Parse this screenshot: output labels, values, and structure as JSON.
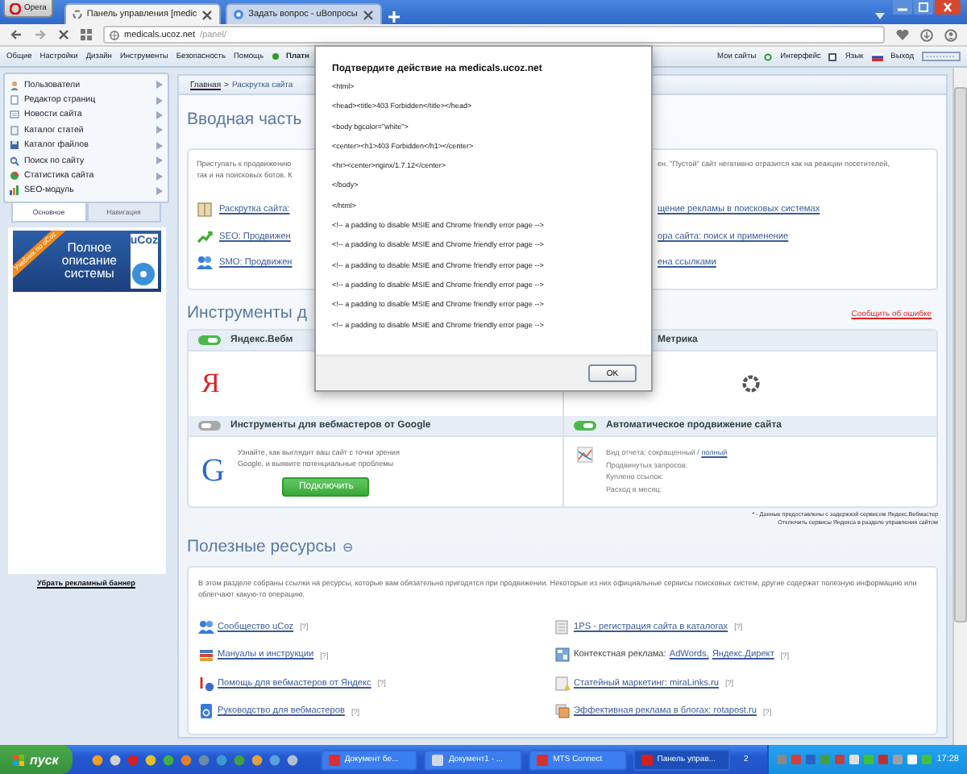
{
  "browser": {
    "opera_button": "Opera",
    "tabs": [
      {
        "title": "Панель управления [medic",
        "selected": true
      },
      {
        "title": "Задать вопрос - uВопросы",
        "selected": false
      }
    ],
    "address": {
      "host": "medicals.ucoz.net",
      "path": "/panel/"
    }
  },
  "top_menu": {
    "items": [
      {
        "label": "Общие",
        "kind": "plain"
      },
      {
        "label": "Настройки",
        "kind": "plain"
      },
      {
        "label": "Дизайн",
        "kind": "plain"
      },
      {
        "label": "Инструменты",
        "kind": "plain"
      },
      {
        "label": "Безопасность",
        "kind": "plain"
      },
      {
        "label": "Помощь",
        "kind": "plain"
      },
      {
        "label": "Платн",
        "kind": "paid"
      }
    ],
    "right": [
      {
        "label": "Мои сайты",
        "kind": "refresh"
      },
      {
        "label": "Интерфейс",
        "kind": "window"
      },
      {
        "label": "Язык",
        "kind": "flag"
      },
      {
        "label": "Выход",
        "kind": "plain"
      }
    ]
  },
  "sidebar": {
    "items": [
      "Пользователи",
      "Редактор страниц",
      "Новости сайта",
      "Каталог статей",
      "Каталог файлов",
      "Поиск по сайту",
      "Статистика сайта",
      "SEO-модуль"
    ],
    "tabs": [
      {
        "label": "Основное",
        "selected": true
      },
      {
        "label": "Навигация",
        "selected": false
      }
    ],
    "banner": {
      "ribbon": "Учебник по uCoz",
      "text": "Полное описание системы",
      "logo": "uCoz"
    },
    "remove_banner_link": "Убрать рекламный баннер"
  },
  "breadcrumb": {
    "items": [
      "Главная",
      "Раскрутка сайта"
    ],
    "separator": ">"
  },
  "intro": {
    "title": "Вводная часть",
    "text_left": [
      "Приступать к продвижению",
      "так и на поисковых ботов. К"
    ],
    "text_right": [
      "ен. \"Пустой\" сайт негативно отразится как на реакции посетителей,"
    ],
    "links_left": [
      {
        "kind": "book",
        "label": "Раскрутка сайта:"
      },
      {
        "kind": "growth",
        "label": "SEO: Продвижен"
      },
      {
        "kind": "people",
        "label": "SMO: Продвижен"
      }
    ],
    "links_right": [
      "щение рекламы в поисковых системах",
      "ора сайта: поиск и применение",
      "ена ссылками"
    ]
  },
  "tools": {
    "title": "Инструменты д",
    "report_link": "Сообщить об ошибке",
    "cards": [
      {
        "kind": "yandex",
        "title": "Яндекс.Вебм",
        "on": true,
        "logo": "Я"
      },
      {
        "kind": "loading",
        "title": "Метрика"
      },
      {
        "kind": "google",
        "title": "Инструменты для вебмастеров от Google",
        "on": false,
        "logo": "G",
        "text": "Узнайте, как выглядит ваш сайт с точки зрения Google, и выявите потенциальные проблемы",
        "button": "Подключить"
      },
      {
        "kind": "report",
        "title": "Автоматическое продвижение сайта",
        "on": true,
        "report_label": "Вид отчета: сокращенный /",
        "report_link": "полный",
        "lines": [
          "Продвинутых запросов:",
          "Куплено ссылок:",
          "Расход в месяц:"
        ]
      }
    ],
    "notes": [
      "* - Данные предоставлены с задержкой сервисом Яндекс.Вебмастер",
      "Отключить сервисы Яндекса в разделе управления сайтом"
    ]
  },
  "resources": {
    "title": "Полезные ресурсы",
    "collapse": "⊖",
    "text": "В этом разделе собраны ссылки на ресурсы, которые вам обязательно пригодятся при продвижении. Некоторые из них официальные сервисы поисковых систем, другие содержат полезную информацию или облегчают какую-то операцию.",
    "links": [
      {
        "kind": "people",
        "links": [
          "Сообщество uCoz"
        ],
        "help": "[?]"
      },
      {
        "kind": "catalog",
        "links": [
          "1PS - регистрация сайта в каталогах"
        ],
        "help": "[?]"
      },
      {
        "kind": "books",
        "links": [
          "Мануалы и инструкции"
        ],
        "help": "[?]"
      },
      {
        "kind": "ads",
        "prefix": "Контекстная реклама:",
        "links": [
          "AdWords,",
          "Яндекс.Директ"
        ],
        "help": "[?]"
      },
      {
        "kind": "yandex",
        "links": [
          "Помощь для вебмастеров от Яндекс"
        ],
        "help": "[?]"
      },
      {
        "kind": "article",
        "links": [
          "Статейный маркетинг: miraLinks.ru"
        ],
        "help": "[?]"
      },
      {
        "kind": "guide",
        "links": [
          "Руководство для вебмастеров"
        ],
        "help": "[?]"
      },
      {
        "kind": "blog",
        "links": [
          "Эффективная реклама в блогах: rotapost.ru"
        ],
        "help": "[?]"
      }
    ]
  },
  "dialog": {
    "title": "Подтвердите действие на medicals.ucoz.net",
    "lines": [
      "<html>",
      "<head><title>403 Forbidden</title></head>",
      "<body bgcolor=\"white\">",
      "<center><h1>403 Forbidden</h1></center>",
      "<hr><center>nginx/1.7.12</center>",
      "</body>",
      "</html>",
      "<!-- a padding to disable MSIE and Chrome friendly error page -->",
      "<!-- a padding to disable MSIE and Chrome friendly error page -->",
      "<!-- a padding to disable MSIE and Chrome friendly error page -->",
      "<!-- a padding to disable MSIE and Chrome friendly error page -->",
      "<!-- a padding to disable MSIE and Chrome friendly error page -->",
      "<!-- a padding to disable MSIE and Chrome friendly error page -->"
    ],
    "ok": "OK"
  },
  "taskbar": {
    "start": "пуск",
    "tasks": [
      {
        "label": "Документ бе...",
        "selected": false
      },
      {
        "label": "Документ1 - ...",
        "selected": false
      },
      {
        "label": "MTS Connect",
        "selected": false
      },
      {
        "label": "Панель управ...",
        "selected": true
      }
    ],
    "group_count": "2",
    "clock": "17:28"
  }
}
